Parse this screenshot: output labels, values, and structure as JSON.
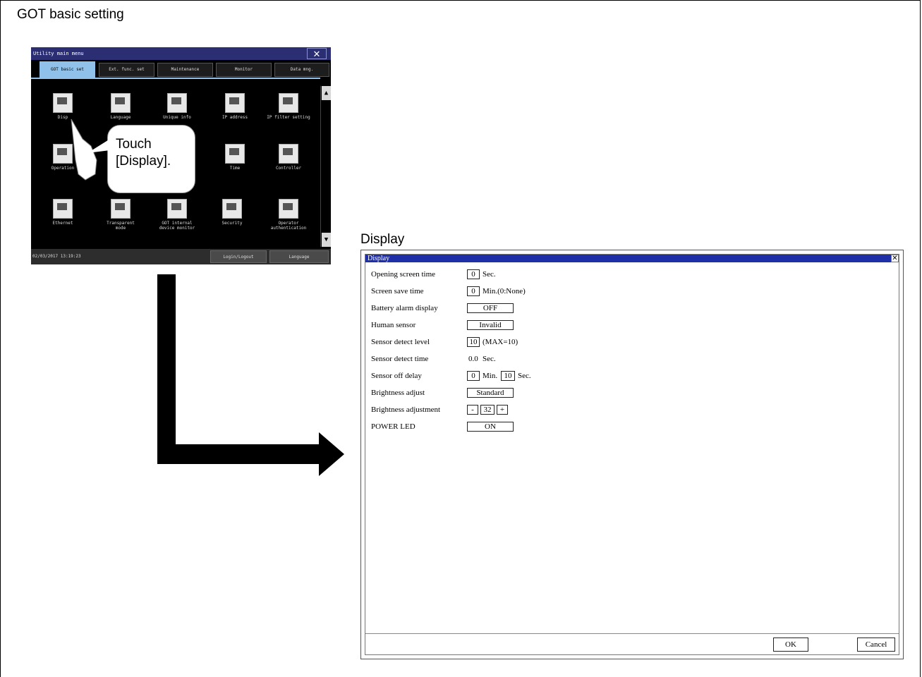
{
  "headings": {
    "got_basic_setting": "GOT basic setting",
    "display": "Display"
  },
  "got_screen": {
    "title": "Utility main menu",
    "tabs": [
      "GOT basic set",
      "Ext. func. set",
      "Maintenance",
      "Monitor",
      "Data mng."
    ],
    "icons": [
      {
        "label": "Disp",
        "icon": "display-icon"
      },
      {
        "label": "Language",
        "icon": "language-icon"
      },
      {
        "label": "Unique info",
        "icon": "unique-info-icon"
      },
      {
        "label": "IP address",
        "icon": "ip-address-icon"
      },
      {
        "label": "IP filter setting",
        "icon": "ip-filter-icon"
      },
      {
        "label": "Operation",
        "icon": "operation-icon"
      },
      {
        "label": "Time",
        "icon": "time-icon"
      },
      {
        "label": "Controller",
        "icon": "controller-icon"
      },
      {
        "label": "Ethernet",
        "icon": "ethernet-icon"
      },
      {
        "label": "Transparent\nmode",
        "icon": "transparent-mode-icon"
      },
      {
        "label": "GOT internal\ndevice monitor",
        "icon": "device-monitor-icon"
      },
      {
        "label": "Security",
        "icon": "security-icon"
      },
      {
        "label": "Operator\nauthentication",
        "icon": "operator-authentication-icon"
      }
    ],
    "status_time": "02/03/2017 13:19:23",
    "login_button": "Login/Logout",
    "language_button": "Language",
    "callout": "Touch\n[Display]."
  },
  "display_dialog": {
    "title": "Display",
    "rows": {
      "opening_label": "Opening screen time",
      "opening_value": "0",
      "opening_unit": "Sec.",
      "screensave_label": "Screen save time",
      "screensave_value": "0",
      "screensave_unit": "Min.(0:None)",
      "battery_label": "Battery alarm display",
      "battery_value": "OFF",
      "human_label": "Human sensor",
      "human_value": "Invalid",
      "detect_level_label": "Sensor detect level",
      "detect_level_value": "10",
      "detect_level_unit": "(MAX=10)",
      "detect_time_label": "Sensor detect time",
      "detect_time_value": "0.0",
      "detect_time_unit": "Sec.",
      "off_delay_label": "Sensor off delay",
      "off_delay_min": "0",
      "off_delay_min_unit": "Min.",
      "off_delay_sec": "10",
      "off_delay_sec_unit": "Sec.",
      "brightness_label": "Brightness adjust",
      "brightness_value": "Standard",
      "brightness_adj_label": "Brightness adjustment",
      "brightness_minus": "-",
      "brightness_adj_value": "32",
      "brightness_plus": "+",
      "power_led_label": "POWER LED",
      "power_led_value": "ON"
    },
    "ok_button": "OK",
    "cancel_button": "Cancel"
  }
}
